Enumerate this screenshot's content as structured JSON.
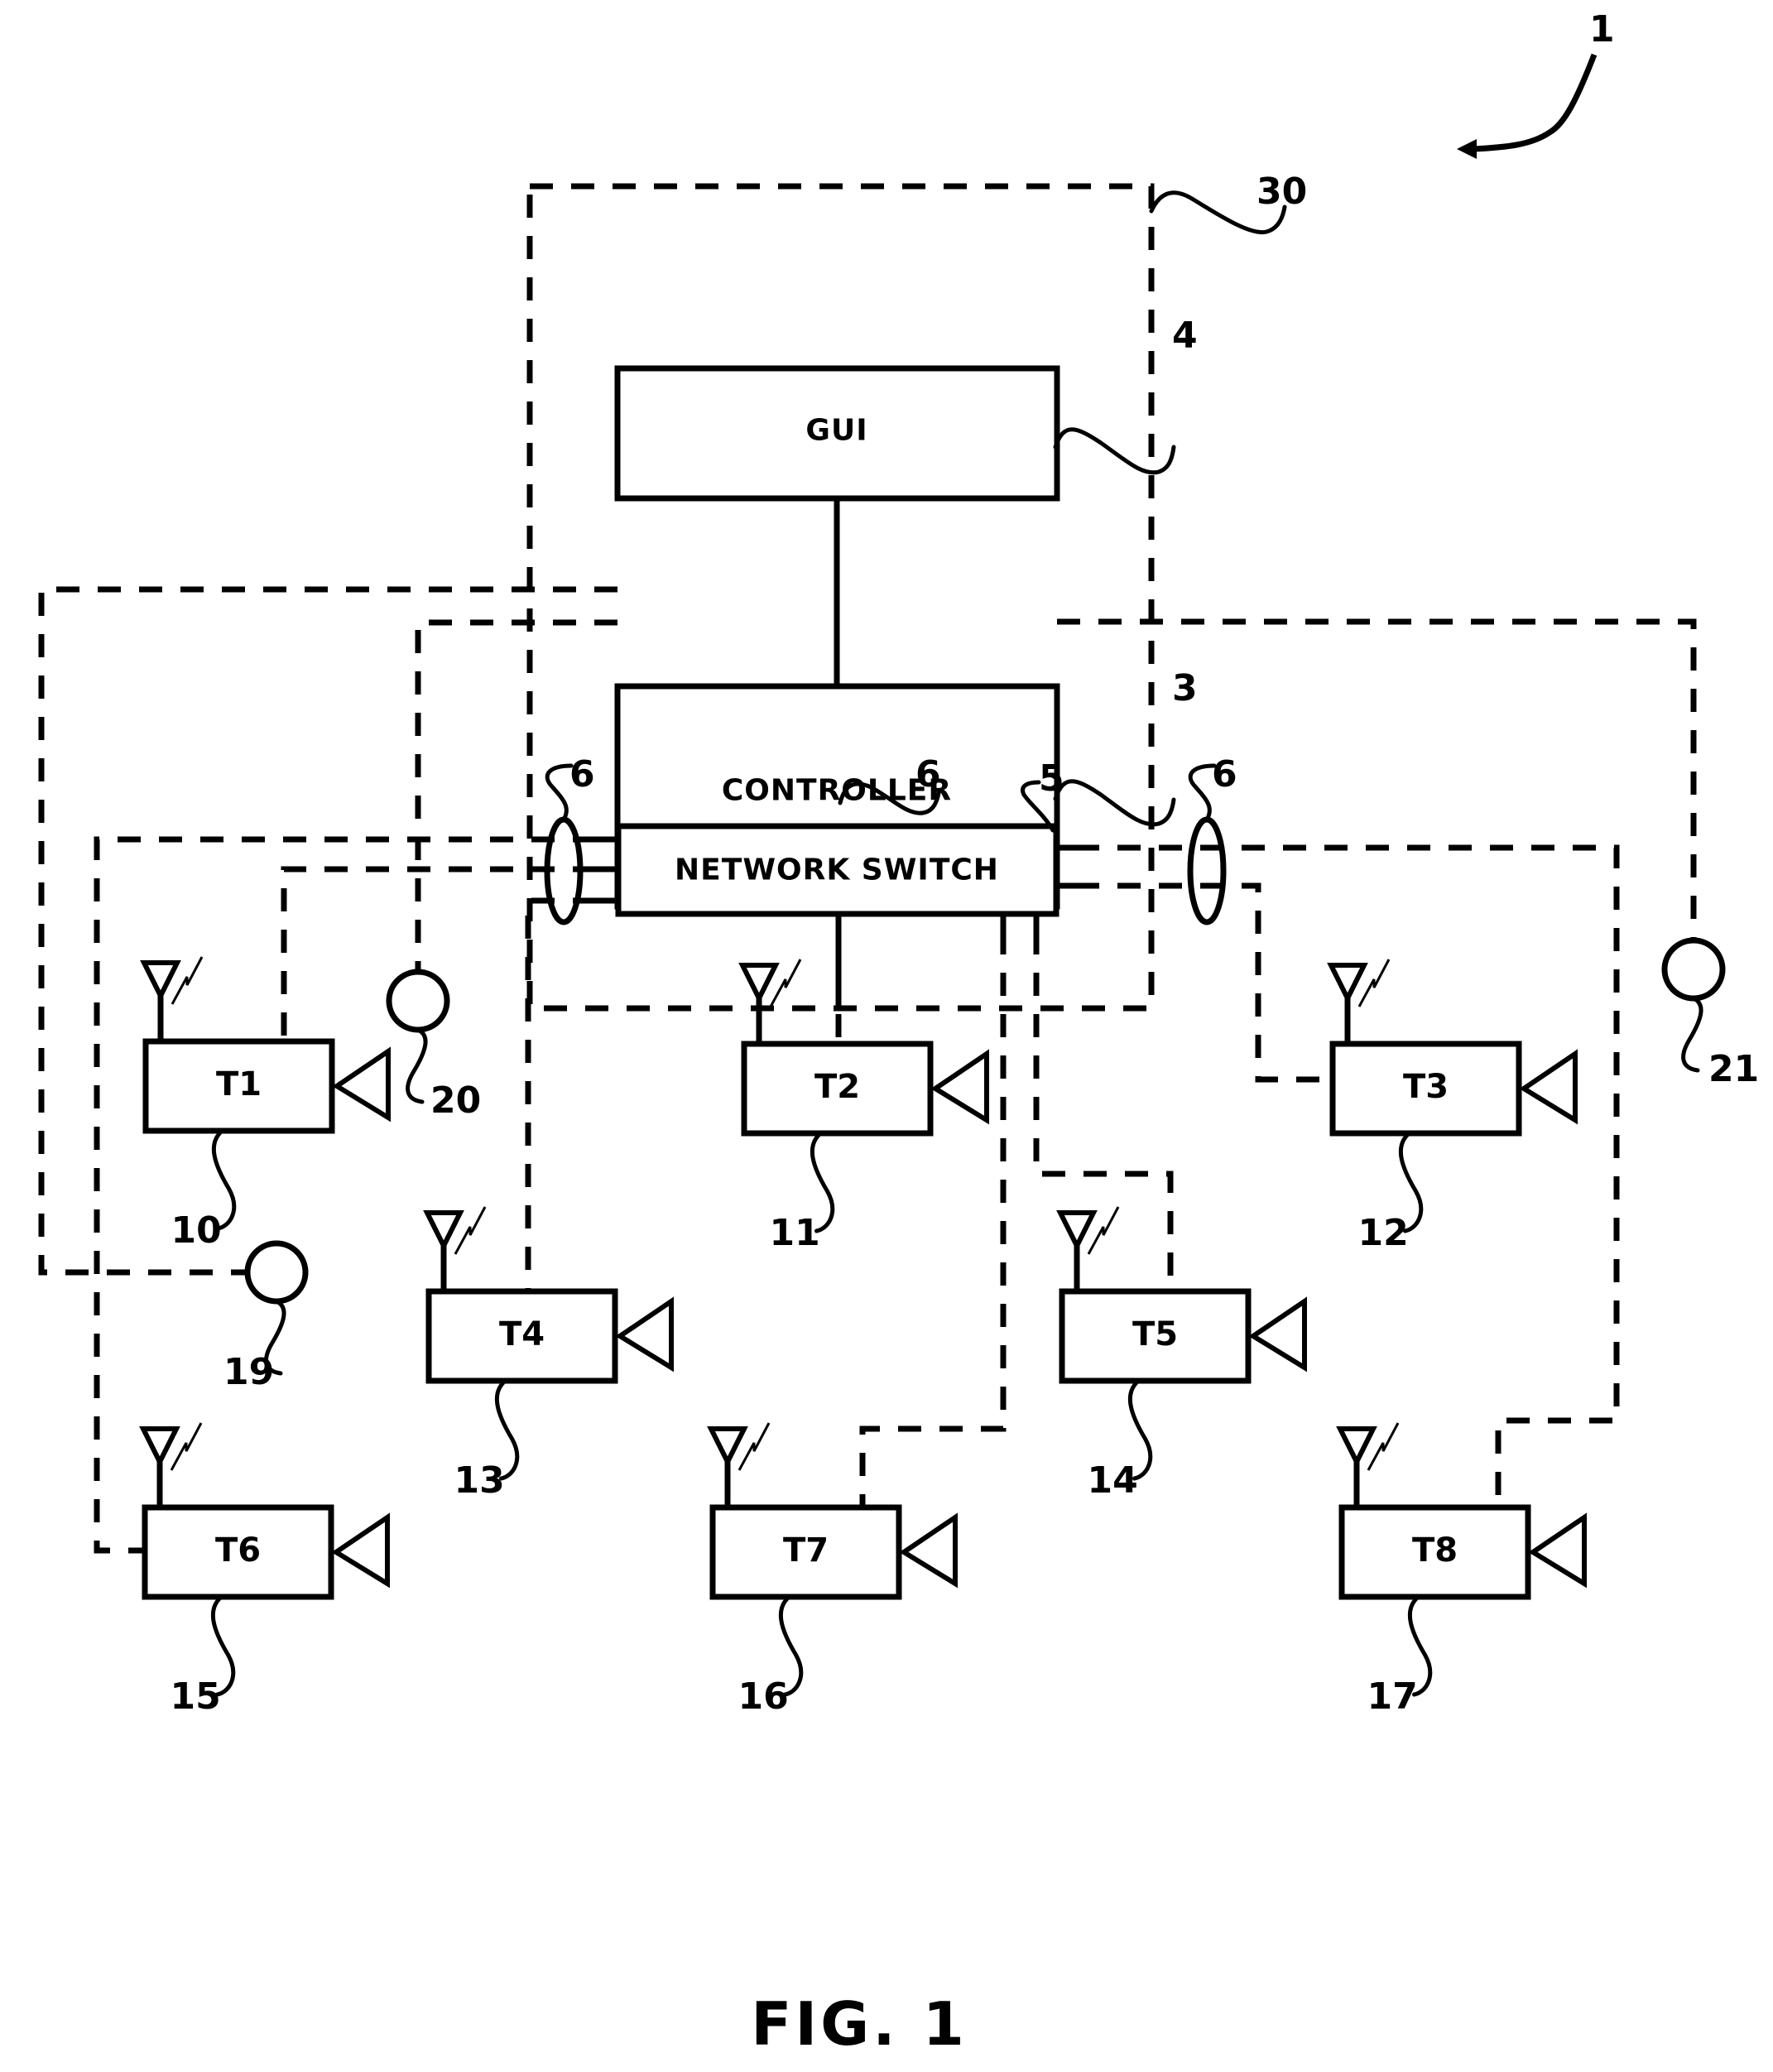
{
  "figure": {
    "caption": "FIG. 1",
    "system_ref": "1"
  },
  "enclosure": {
    "ref": "30"
  },
  "blocks": {
    "gui": {
      "label": "GUI",
      "ref": "4"
    },
    "controller": {
      "label": "CONTROLLER",
      "ref": "3"
    },
    "network_switch": {
      "label": "NETWORK SWITCH",
      "ref": "5"
    }
  },
  "links": {
    "controller_to_switch_ref": "6",
    "left_bundle_ref": "6",
    "right_bundle_ref": "6"
  },
  "terminals": [
    {
      "label": "T1",
      "ref": "10"
    },
    {
      "label": "T2",
      "ref": "11"
    },
    {
      "label": "T3",
      "ref": "12"
    },
    {
      "label": "T4",
      "ref": "13"
    },
    {
      "label": "T5",
      "ref": "14"
    },
    {
      "label": "T6",
      "ref": "15"
    },
    {
      "label": "T7",
      "ref": "16"
    },
    {
      "label": "T8",
      "ref": "17"
    }
  ],
  "sensors": [
    {
      "ref": "19"
    },
    {
      "ref": "20"
    },
    {
      "ref": "21"
    }
  ]
}
